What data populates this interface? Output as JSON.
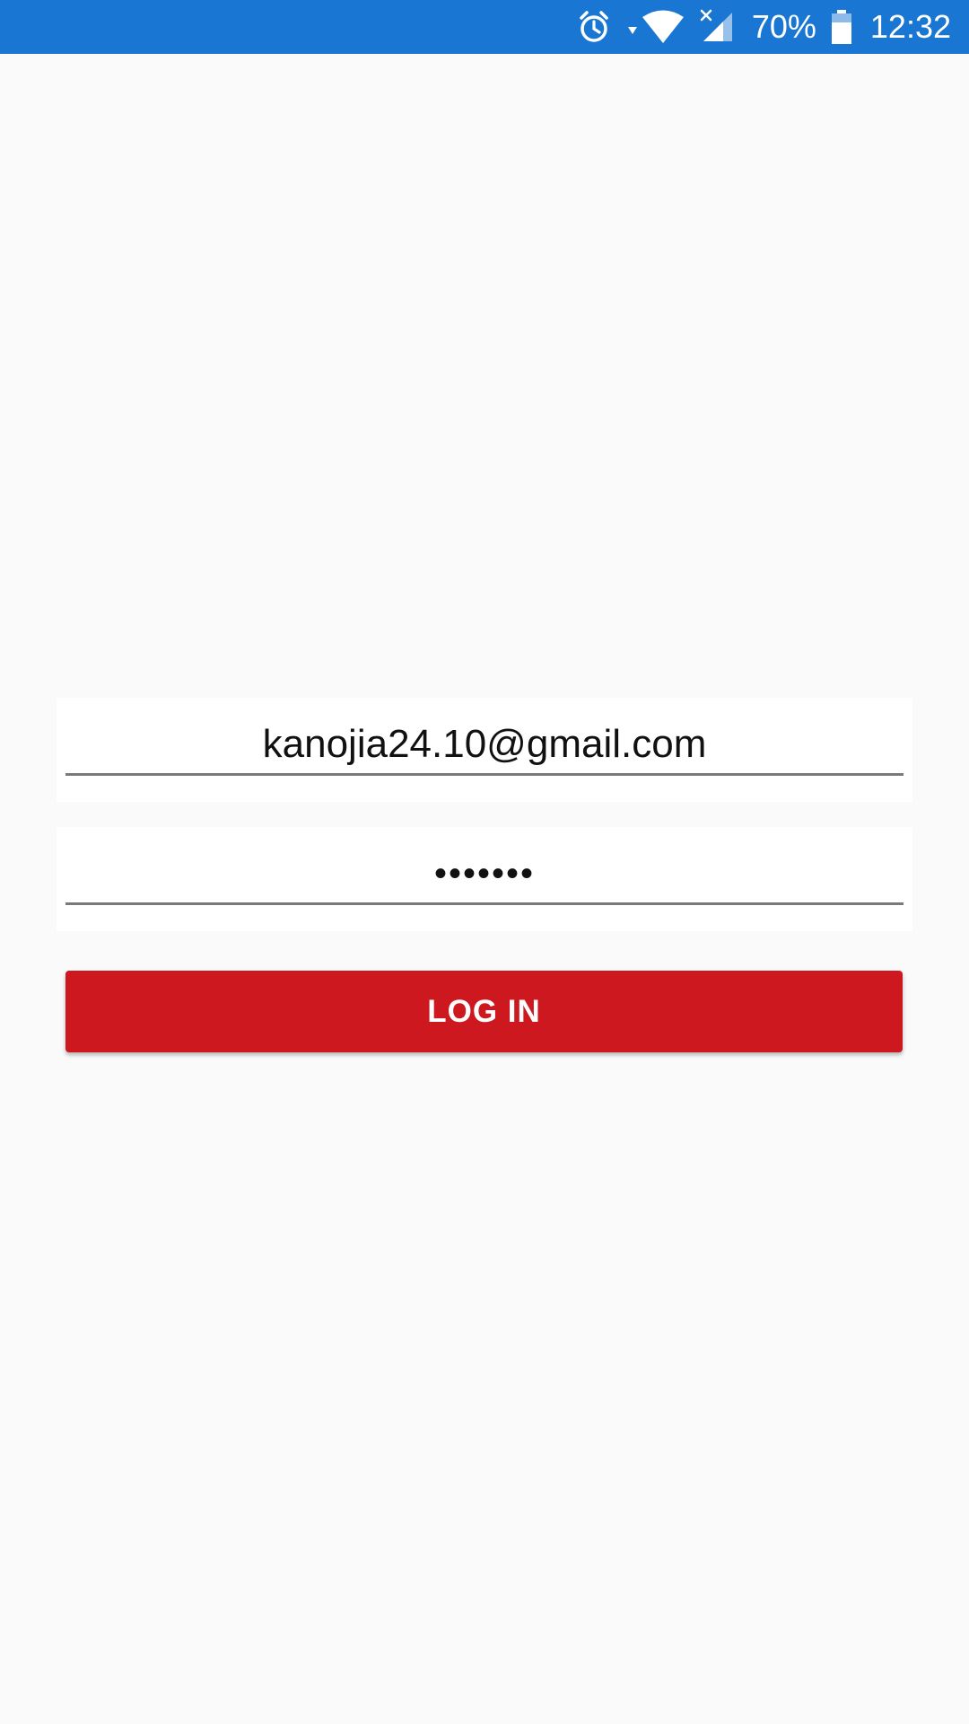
{
  "status_bar": {
    "background_color": "#1976d2",
    "icons": [
      "alarm-icon",
      "wifi-icon",
      "cellular-signal-icon",
      "battery-icon"
    ],
    "battery_percent": "70%",
    "time": "12:32"
  },
  "login_form": {
    "email": {
      "value": "kanojia24.10@gmail.com"
    },
    "password": {
      "masked_value": "•••••••"
    },
    "login_button": {
      "label": "LOG IN",
      "color": "#cd1820"
    }
  }
}
